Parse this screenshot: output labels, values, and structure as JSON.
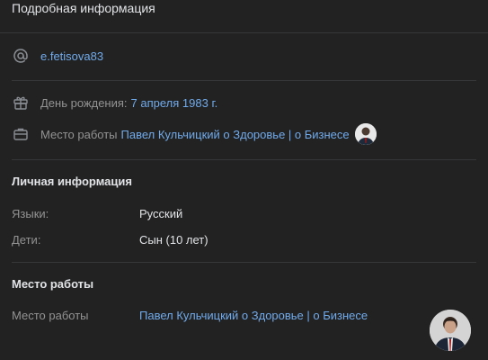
{
  "header": {
    "title": "Подробная информация"
  },
  "contacts": {
    "username": "e.fetisova83"
  },
  "basic": {
    "birthday_label": "День рождения:",
    "birthday_value": "7 апреля 1983 г.",
    "work_label": "Место работы",
    "work_value": "Павел Кульчицкий о Здоровье | о Бизнесе"
  },
  "personal": {
    "title": "Личная информация",
    "languages_label": "Языки:",
    "languages_value": "Русский",
    "children_label": "Дети:",
    "children_value": "Сын (10 лет)"
  },
  "career": {
    "title": "Место работы",
    "work_label": "Место работы",
    "work_value": "Павел Кульчицкий о Здоровье | о Бизнесе"
  },
  "colors": {
    "background": "#222222",
    "link": "#71aaeb",
    "muted": "#939393",
    "divider": "#363738"
  },
  "icons": {
    "contact": "at-icon",
    "birthday": "gift-icon",
    "work": "briefcase-icon"
  }
}
